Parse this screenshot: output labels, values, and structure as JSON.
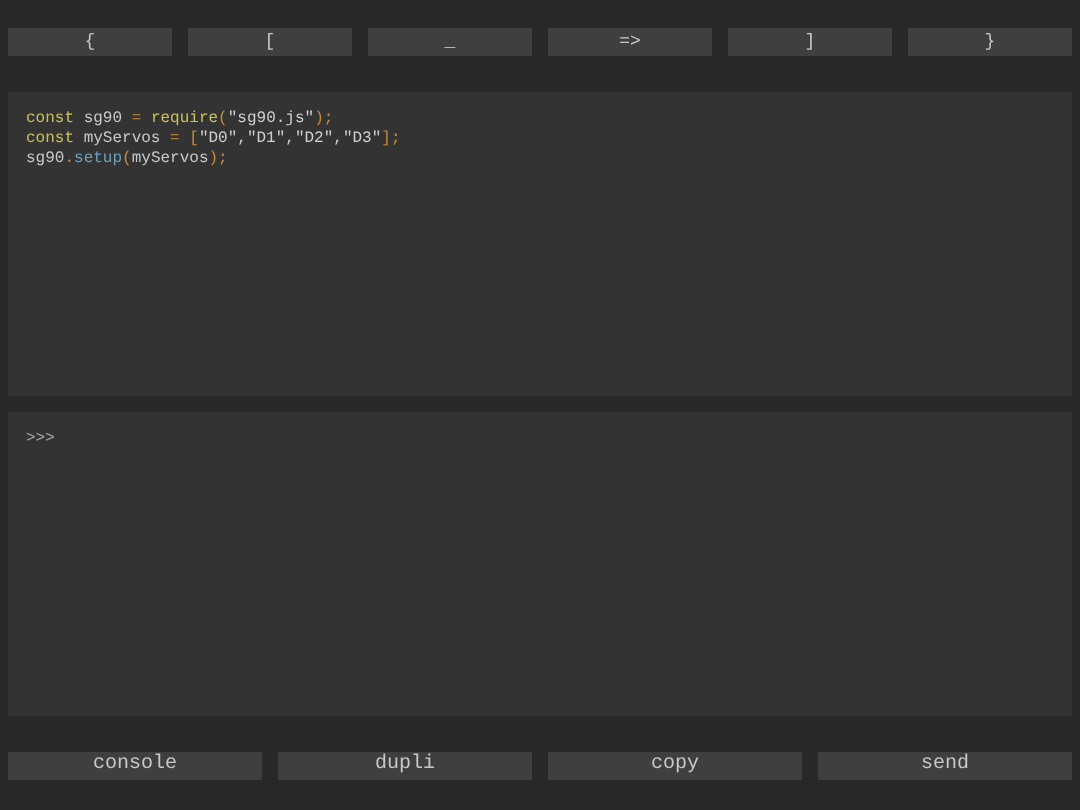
{
  "key_buttons": [
    "{",
    "[",
    "_",
    "=>",
    "]",
    "}"
  ],
  "editor": {
    "lines": [
      [
        {
          "kind": "keyword",
          "text": "const"
        },
        {
          "kind": "plain",
          "text": " sg90 "
        },
        {
          "kind": "punct",
          "text": "= "
        },
        {
          "kind": "keyword",
          "text": "require"
        },
        {
          "kind": "punct",
          "text": "("
        },
        {
          "kind": "string",
          "text": "\"sg90.js\""
        },
        {
          "kind": "punct",
          "text": ");"
        }
      ],
      [
        {
          "kind": "keyword",
          "text": "const"
        },
        {
          "kind": "plain",
          "text": " myServos "
        },
        {
          "kind": "punct",
          "text": "= ["
        },
        {
          "kind": "string",
          "text": "\"D0\",\"D1\",\"D2\",\"D3\""
        },
        {
          "kind": "punct",
          "text": "];"
        }
      ],
      [
        {
          "kind": "plain",
          "text": "sg90"
        },
        {
          "kind": "punct",
          "text": "."
        },
        {
          "kind": "method",
          "text": "setup"
        },
        {
          "kind": "punct",
          "text": "("
        },
        {
          "kind": "plain",
          "text": "myServos"
        },
        {
          "kind": "punct",
          "text": ");"
        }
      ]
    ]
  },
  "console": {
    "prompt": ">>>"
  },
  "action_buttons": [
    "console",
    "dupli",
    "copy",
    "send"
  ]
}
